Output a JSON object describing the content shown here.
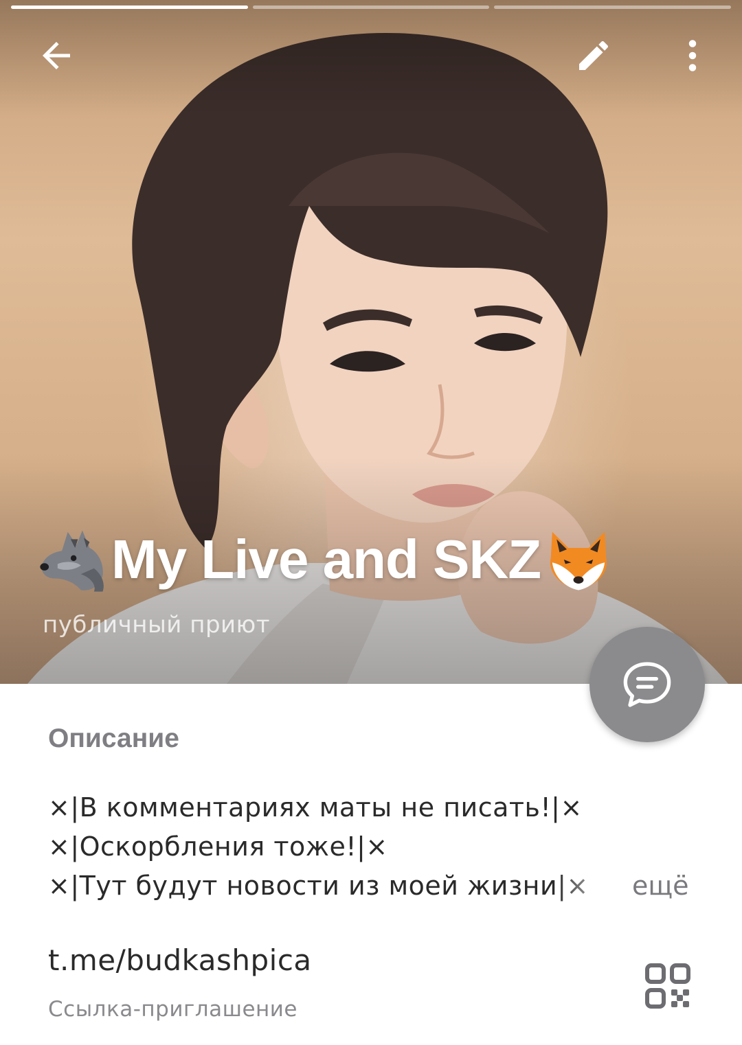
{
  "progress": {
    "segments": 3,
    "active_index": 0
  },
  "header": {
    "back_icon": "arrow-left-icon",
    "edit_icon": "pencil-icon",
    "more_icon": "more-vertical-icon",
    "photo": "channel-avatar-photo",
    "title": "My Live and SKZ",
    "title_prefix_emoji": "wolf-emoji",
    "title_suffix_emoji": "fox-emoji",
    "status": "публичный приют"
  },
  "fab": {
    "icon": "chat-bubble-icon",
    "color": "#8b8b8e"
  },
  "info": {
    "section_title": "Описание",
    "description_lines": [
      "×|В комментариях маты не писать!|×",
      "×|Оскорбления тоже!|×",
      "×|Тут будут новости из моей жизни|×"
    ],
    "more_label": "ещё",
    "link": "t.me/budkashpica",
    "link_caption": "Ссылка-приглашение",
    "qr_icon": "qr-code-icon"
  },
  "colors": {
    "header_bg": "#d8b08a",
    "section_title": "#7f7f83",
    "text_primary": "#2a2a2a",
    "text_secondary": "#8a8a8e"
  }
}
